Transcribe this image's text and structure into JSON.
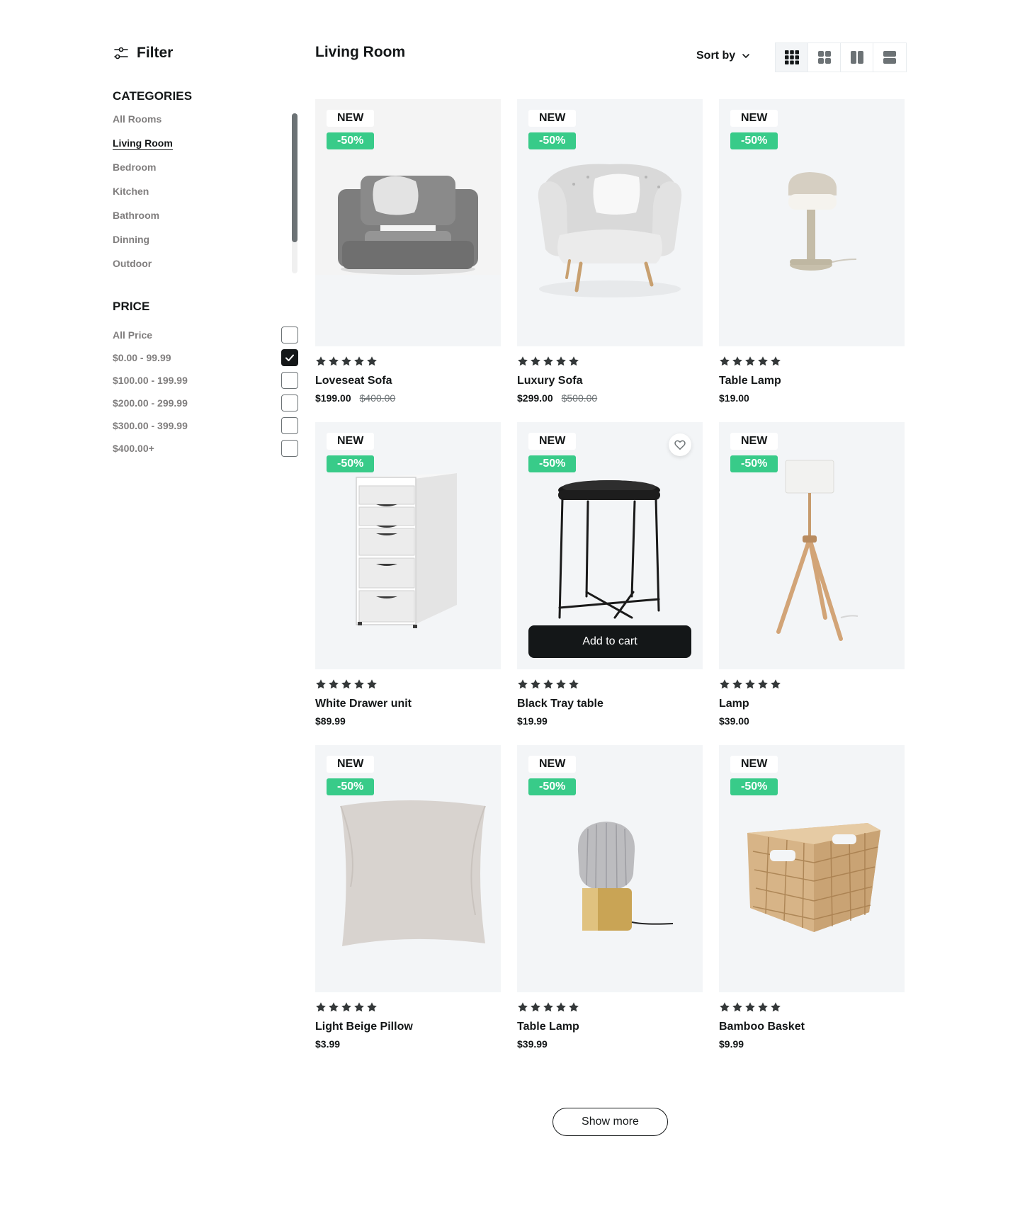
{
  "sidebar": {
    "filter_label": "Filter",
    "categories_title": "CATEGORIES",
    "categories": [
      "All Rooms",
      "Living Room",
      "Bedroom",
      "Kitchen",
      "Bathroom",
      "Dinning",
      "Outdoor"
    ],
    "active_category": "Living Room",
    "price_title": "PRICE",
    "prices": [
      {
        "label": "All Price",
        "checked": false
      },
      {
        "label": "$0.00 - 99.99",
        "checked": true
      },
      {
        "label": "$100.00 - 199.99",
        "checked": false
      },
      {
        "label": "$200.00 - 299.99",
        "checked": false
      },
      {
        "label": "$300.00 - 399.99",
        "checked": false
      },
      {
        "label": "$400.00+",
        "checked": false
      }
    ]
  },
  "header": {
    "title": "Living Room",
    "sort_label": "Sort by",
    "views": [
      "grid-3-icon",
      "grid-2-icon",
      "columns-icon",
      "rows-icon"
    ],
    "active_view": "grid-3-icon"
  },
  "products": [
    {
      "name": "Loveseat Sofa",
      "price": "$199.00",
      "old_price": "$400.00",
      "badge_new": "NEW",
      "badge_discount": "-50%",
      "image": "armchair-gray",
      "rating": 5
    },
    {
      "name": "Luxury Sofa",
      "price": "$299.00",
      "old_price": "$500.00",
      "badge_new": "NEW",
      "badge_discount": "-50%",
      "image": "armchair-white",
      "rating": 5
    },
    {
      "name": "Table Lamp",
      "price": "$19.00",
      "old_price": "",
      "badge_new": "NEW",
      "badge_discount": "-50%",
      "image": "table-lamp-beige",
      "rating": 5
    },
    {
      "name": "White Drawer unit",
      "price": "$89.99",
      "old_price": "",
      "badge_new": "NEW",
      "badge_discount": "-50%",
      "image": "drawer-unit",
      "rating": 5
    },
    {
      "name": "Black Tray table",
      "price": "$19.99",
      "old_price": "",
      "badge_new": "NEW",
      "badge_discount": "-50%",
      "image": "tray-table",
      "rating": 5,
      "hovered": true,
      "cart_label": "Add to cart"
    },
    {
      "name": "Lamp",
      "price": "$39.00",
      "old_price": "",
      "badge_new": "NEW",
      "badge_discount": "-50%",
      "image": "floor-lamp",
      "rating": 5
    },
    {
      "name": "Light Beige Pillow",
      "price": "$3.99",
      "old_price": "",
      "badge_new": "NEW",
      "badge_discount": "-50%",
      "image": "pillow",
      "rating": 5
    },
    {
      "name": "Table Lamp",
      "price": "$39.99",
      "old_price": "",
      "badge_new": "NEW",
      "badge_discount": "-50%",
      "image": "glass-lamp",
      "rating": 5
    },
    {
      "name": "Bamboo Basket",
      "price": "$9.99",
      "old_price": "",
      "badge_new": "NEW",
      "badge_discount": "-50%",
      "image": "basket",
      "rating": 5
    }
  ],
  "show_more_label": "Show more",
  "colors": {
    "discount": "#38cb89",
    "primary": "#141718",
    "muted": "#807e7e",
    "card_bg": "#f3f5f7"
  }
}
